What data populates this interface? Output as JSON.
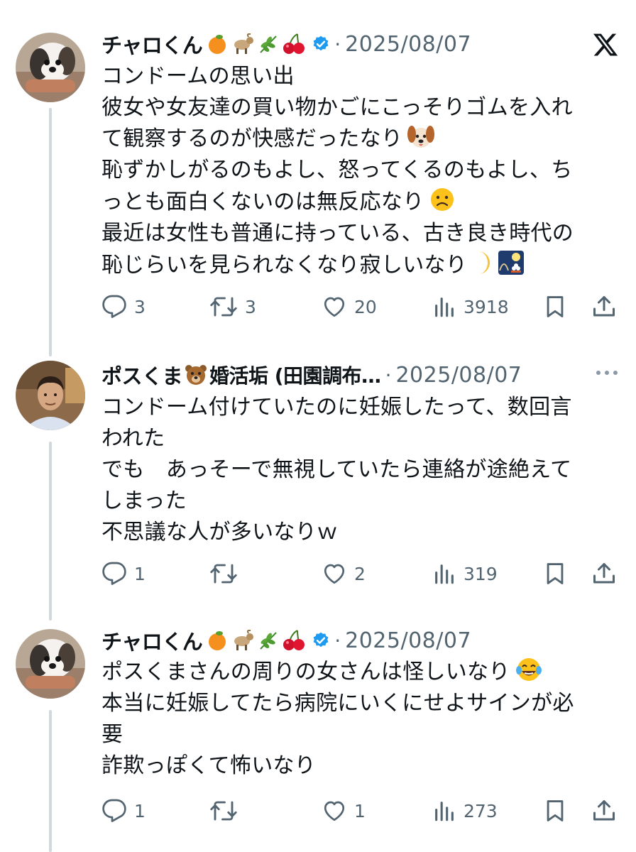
{
  "tweets": [
    {
      "author": "チャロくん",
      "date": "2025/08/07",
      "separator": "·",
      "lines": [
        "コンドームの思い出",
        "彼女や女友達の買い物かごにこっそりゴムを入れ",
        "て観察するのが快感だったなり",
        "恥ずかしがるのもよし、怒ってくるのもよし、ち",
        "っとも面白くないのは無反応なり",
        "最近は女性も普通に持っている、古き良き時代の",
        "恥じらいを見られなくなり寂しいなり"
      ],
      "replies": "3",
      "reposts": "3",
      "likes": "20",
      "views": "3918"
    },
    {
      "author": "ポスくま",
      "author_suffix": "婚活垢 (田園調布…",
      "date": "2025/08/07",
      "separator": "·",
      "lines": [
        "コンドーム付けていたのに妊娠したって、数回言",
        "われた",
        "でも　あっそーで無視していたら連絡が途絶えて",
        "しまった",
        "不思議な人が多いなりｗ"
      ],
      "replies": "1",
      "reposts": "",
      "likes": "2",
      "views": "319"
    },
    {
      "author": "チャロくん",
      "date": "2025/08/07",
      "separator": "·",
      "lines": [
        "ポスくまさんの周りの女さんは怪しいなり",
        "本当に妊娠してたら病院にいくにせよサインが必",
        "要",
        "詐欺っぽくて怖いなり"
      ],
      "replies": "1",
      "reposts": "",
      "likes": "1",
      "views": "273"
    }
  ],
  "icons": {
    "name_emojis": [
      "orange-emoji",
      "goat-emoji",
      "herb-emoji",
      "cherries-emoji"
    ],
    "verified": "verified-badge-icon",
    "brand": "x-logo-icon",
    "menu": "more-icon",
    "line_emojis": [
      "dog-face-emoji",
      "slightly-frowning-face-emoji",
      "crescent-moon-emoji",
      "moon-viewing-ceremony-emoji",
      "bear-emoji",
      "tears-of-joy-emoji"
    ]
  },
  "colors": {
    "text": "#0f1419",
    "secondary": "#536471",
    "verified": "#1d9bf0",
    "thread_line": "#cfd9de"
  }
}
